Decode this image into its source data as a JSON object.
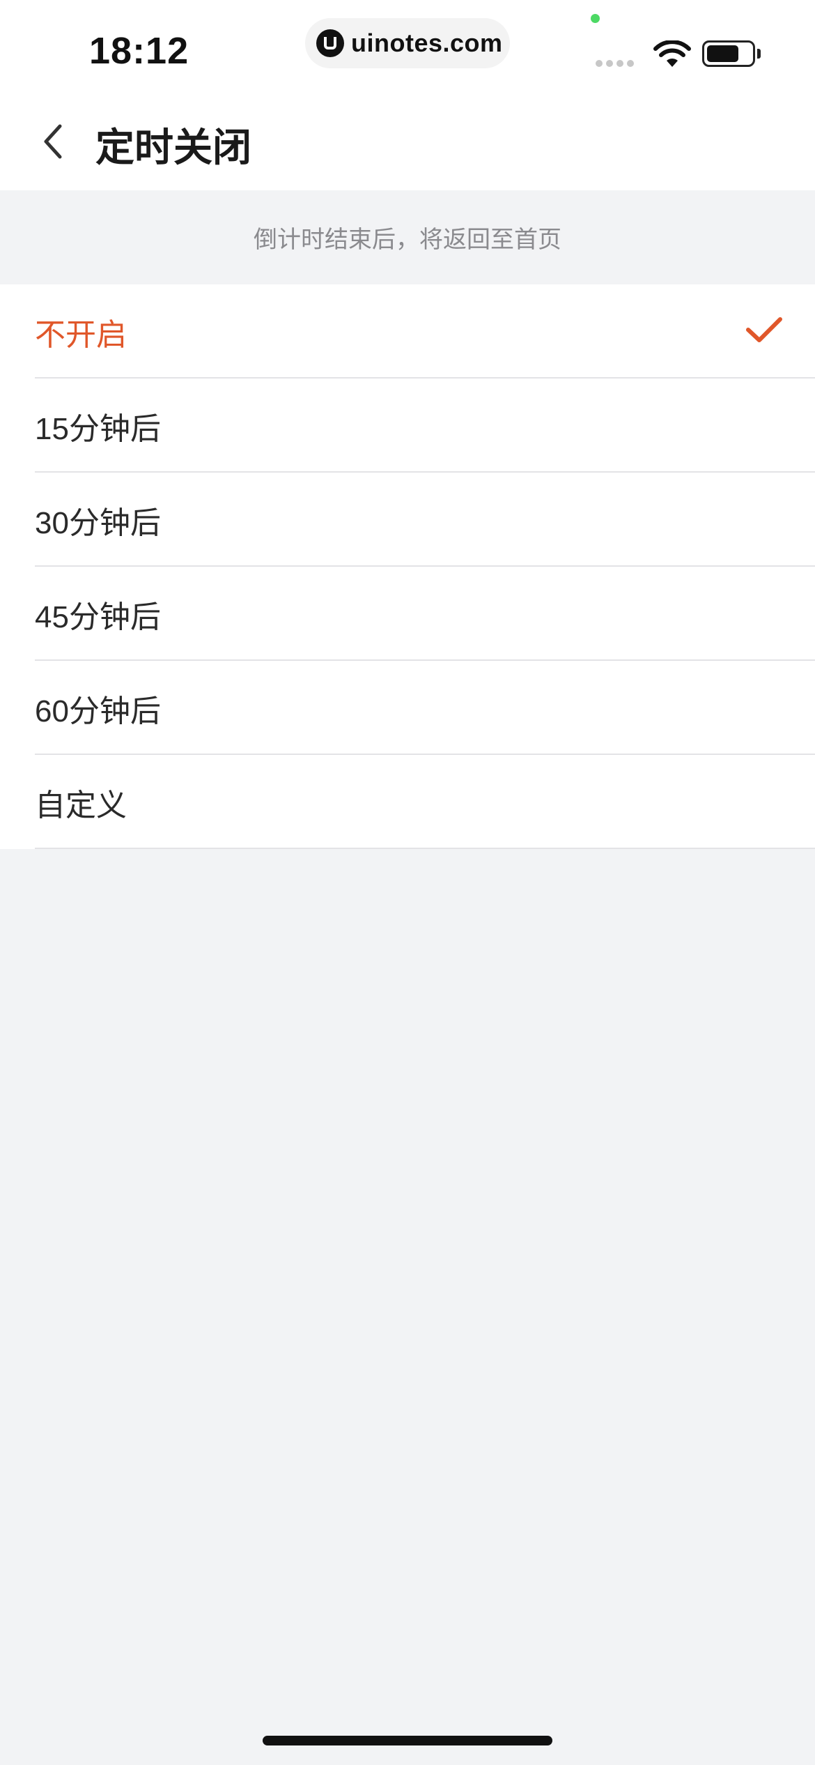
{
  "status_bar": {
    "time": "18:12",
    "url": "uinotes.com",
    "icons": [
      "camera-in-use-dot",
      "cellular-signal-icon",
      "wifi-icon",
      "battery-icon"
    ]
  },
  "nav": {
    "back_icon": "chevron-left-icon",
    "title": "定时关闭"
  },
  "hint": "倒计时结束后，将返回至首页",
  "options": [
    {
      "label": "不开启",
      "selected": true
    },
    {
      "label": "15分钟后",
      "selected": false
    },
    {
      "label": "30分钟后",
      "selected": false
    },
    {
      "label": "45分钟后",
      "selected": false
    },
    {
      "label": "60分钟后",
      "selected": false
    },
    {
      "label": "自定义",
      "selected": false
    }
  ],
  "colors": {
    "accent": "#e0572a",
    "background": "#f2f3f5",
    "card": "#ffffff",
    "hint_text": "#8a8a8e"
  },
  "selected_icon": "checkmark-icon"
}
